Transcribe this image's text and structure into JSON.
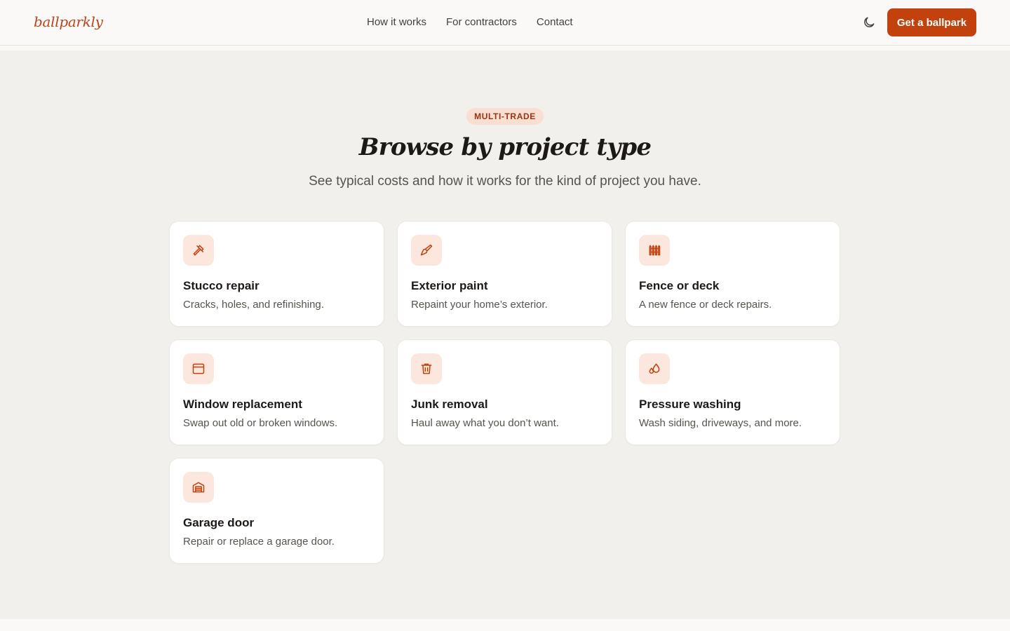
{
  "brand": {
    "logo": "ballparkly",
    "accent": "#c2410c"
  },
  "nav": {
    "items": [
      "How it works",
      "For contractors",
      "Contact"
    ]
  },
  "header": {
    "theme_icon": "moon-icon",
    "cta_label": "Get a ballpark"
  },
  "hero": {
    "badge": "MULTI-TRADE",
    "title": "Browse by project type",
    "subtitle": "See typical costs and how it works for the kind of project you have."
  },
  "projects": [
    {
      "icon": "hammer-icon",
      "title": "Stucco repair",
      "desc": "Cracks, holes, and refinishing."
    },
    {
      "icon": "paintbrush-icon",
      "title": "Exterior paint",
      "desc": "Repaint your home’s exterior."
    },
    {
      "icon": "fence-icon",
      "title": "Fence or deck",
      "desc": "A new fence or deck repairs."
    },
    {
      "icon": "window-icon",
      "title": "Window replacement",
      "desc": "Swap out old or broken windows."
    },
    {
      "icon": "trash-icon",
      "title": "Junk removal",
      "desc": "Haul away what you don’t want."
    },
    {
      "icon": "droplets-icon",
      "title": "Pressure washing",
      "desc": "Wash siding, driveways, and more."
    },
    {
      "icon": "garage-icon",
      "title": "Garage door",
      "desc": "Repair or replace a garage door."
    }
  ]
}
